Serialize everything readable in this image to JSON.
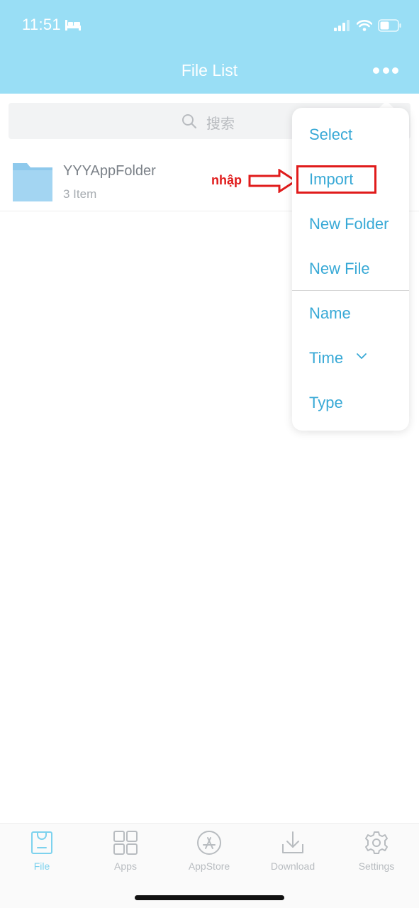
{
  "status": {
    "time": "11:51",
    "icons": [
      "bed-icon",
      "signal-icon",
      "wifi-icon",
      "battery-icon"
    ]
  },
  "header": {
    "title": "File List",
    "more_icon": "ellipsis-icon"
  },
  "search": {
    "placeholder": "搜索",
    "icon": "search-icon"
  },
  "files": [
    {
      "name": "YYYAppFolder",
      "count": "3 Item",
      "icon": "folder-icon"
    }
  ],
  "menu": {
    "items": [
      {
        "label": "Select"
      },
      {
        "label": "Import"
      },
      {
        "label": "New Folder"
      },
      {
        "label": "New File"
      },
      {
        "label": "Name"
      },
      {
        "label": "Time"
      },
      {
        "label": "Type"
      }
    ]
  },
  "annotation": {
    "text": "nhập",
    "color": "#e01b1b"
  },
  "tabs": [
    {
      "label": "File",
      "icon": "file-bag-icon",
      "active": true
    },
    {
      "label": "Apps",
      "icon": "grid-icon",
      "active": false
    },
    {
      "label": "AppStore",
      "icon": "appstore-icon",
      "active": false
    },
    {
      "label": "Download",
      "icon": "download-icon",
      "active": false
    },
    {
      "label": "Settings",
      "icon": "gear-icon",
      "active": false
    }
  ],
  "colors": {
    "header_bg": "#99def5",
    "accent": "#38a9d6",
    "active_tab": "#7dd2ee"
  }
}
